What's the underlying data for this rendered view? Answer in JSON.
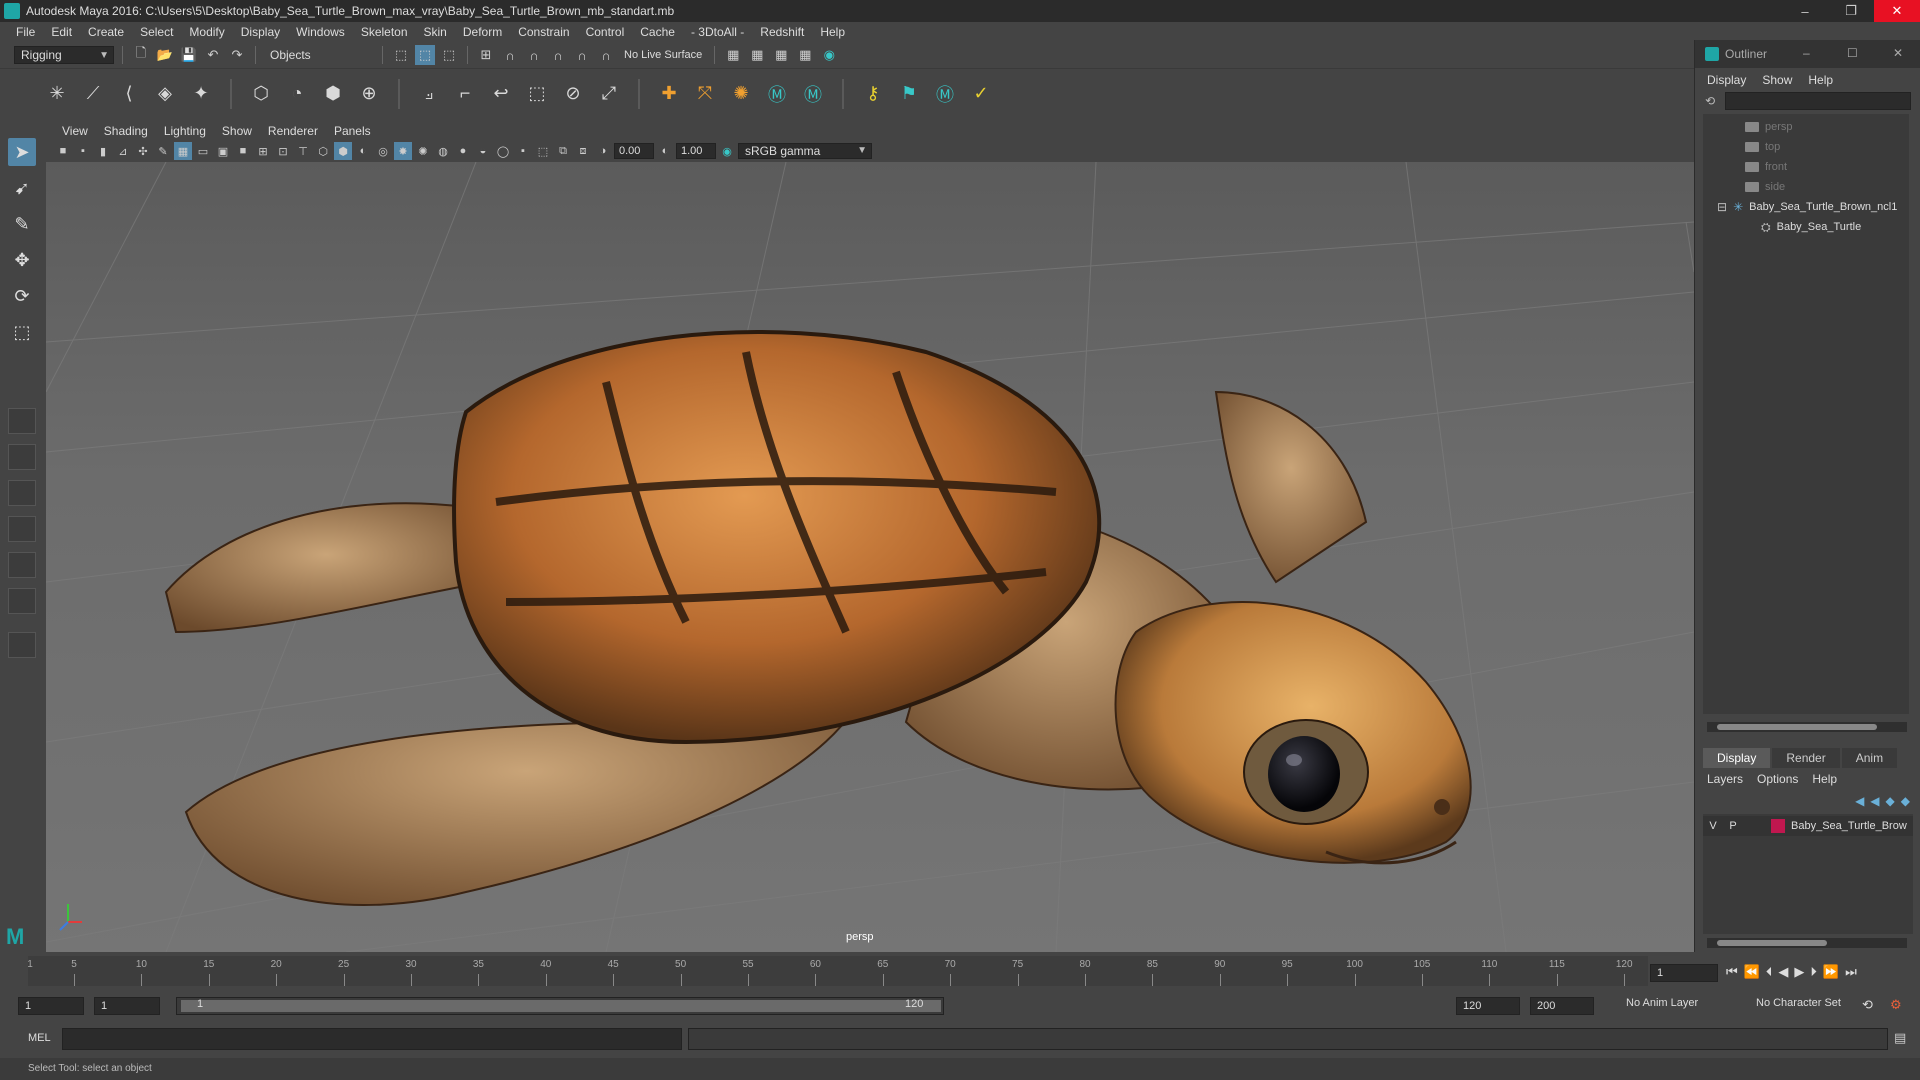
{
  "window": {
    "title": "Autodesk Maya 2016: C:\\Users\\5\\Desktop\\Baby_Sea_Turtle_Brown_max_vray\\Baby_Sea_Turtle_Brown_mb_standart.mb",
    "minimize": "–",
    "restore": "❐",
    "close": "✕"
  },
  "menubar": {
    "items": [
      "File",
      "Edit",
      "Create",
      "Select",
      "Modify",
      "Display",
      "Windows",
      "Skeleton",
      "Skin",
      "Deform",
      "Constrain",
      "Control",
      "Cache",
      "- 3DtoAll -",
      "Redshift",
      "Help"
    ]
  },
  "statusline": {
    "menuset": "Rigging",
    "selection_mode": "Objects",
    "live_surface": "No Live Surface"
  },
  "viewport": {
    "menu": [
      "View",
      "Shading",
      "Lighting",
      "Show",
      "Renderer",
      "Panels"
    ],
    "exposure": "0.00",
    "gamma": "1.00",
    "color_space": "sRGB gamma",
    "camera": "persp"
  },
  "outliner": {
    "title": "Outliner",
    "menu": [
      "Display",
      "Show",
      "Help"
    ],
    "cameras": [
      "persp",
      "top",
      "front",
      "side"
    ],
    "group": "Baby_Sea_Turtle_Brown_ncl1",
    "child": "Baby_Sea_Turtle",
    "minimize": "–",
    "maximize": "☐",
    "close": "✕"
  },
  "layer_editor": {
    "tabs": [
      "Display",
      "Render",
      "Anim"
    ],
    "menu": [
      "Layers",
      "Options",
      "Help"
    ],
    "layer": {
      "v": "V",
      "p": "P",
      "name": "Baby_Sea_Turtle_Brow",
      "color": "#c0174f"
    }
  },
  "timeline": {
    "ticks": [
      "5",
      "10",
      "15",
      "20",
      "25",
      "30",
      "35",
      "40",
      "45",
      "50",
      "55",
      "60",
      "65",
      "70",
      "75",
      "80",
      "85",
      "90",
      "95",
      "100",
      "105",
      "110",
      "115",
      "120"
    ],
    "start_label": "1",
    "current_frame": "1"
  },
  "range": {
    "start": "1",
    "playback_start": "1",
    "bar_start": "1",
    "bar_end": "120",
    "playback_end": "120",
    "end": "200",
    "anim_layer": "No Anim Layer",
    "character_set": "No Character Set"
  },
  "cmdline": {
    "label": "MEL"
  },
  "helpline": {
    "text": "Select Tool: select an object"
  },
  "colors": {
    "accent": "#5285a6",
    "maya_teal": "#1fa6a6",
    "close_red": "#e81123",
    "layer_color": "#c0174f"
  }
}
